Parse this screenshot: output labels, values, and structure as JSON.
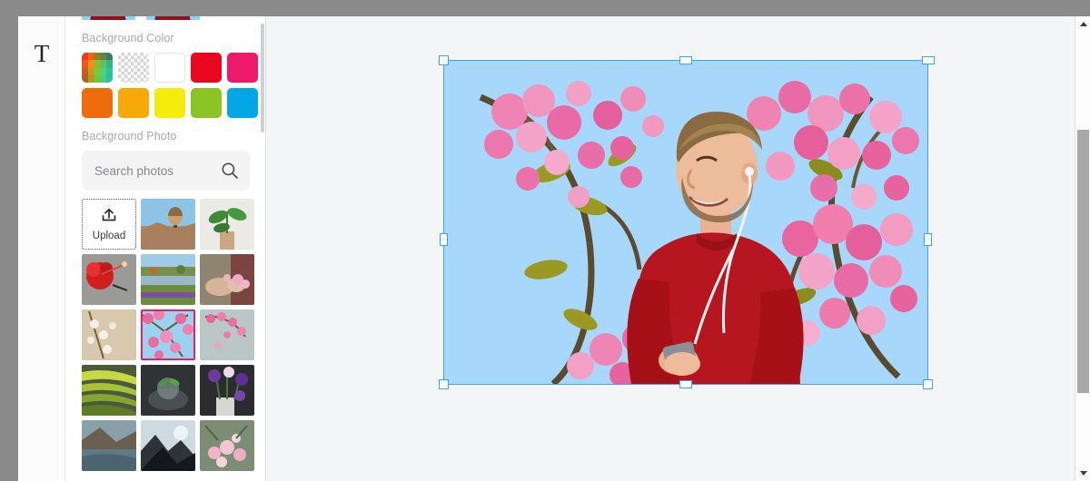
{
  "app": {
    "bg_outer": "#8a8a8a",
    "stage_bg": "#f4f5f6",
    "panel_bg": "#ffffff"
  },
  "tool_rail": {
    "items": [
      {
        "name": "text-tool",
        "glyph": "T",
        "title": "Text"
      }
    ]
  },
  "panel": {
    "template_thumbs": [
      {
        "label": "template-thumb-1"
      },
      {
        "label": "template-thumb-2"
      }
    ],
    "background_color": {
      "label": "Background Color",
      "swatches": [
        {
          "name": "multicolor",
          "kind": "multi",
          "hex": ""
        },
        {
          "name": "transparent",
          "kind": "transparent",
          "hex": ""
        },
        {
          "name": "white",
          "kind": "solid",
          "hex": "#ffffff"
        },
        {
          "name": "red",
          "kind": "solid",
          "hex": "#e8071f"
        },
        {
          "name": "pink",
          "kind": "solid",
          "hex": "#ed1a69"
        },
        {
          "name": "orange",
          "kind": "solid",
          "hex": "#ef6c0c"
        },
        {
          "name": "amber",
          "kind": "solid",
          "hex": "#f6a808"
        },
        {
          "name": "yellow",
          "kind": "solid",
          "hex": "#f6ec0b"
        },
        {
          "name": "green",
          "kind": "solid",
          "hex": "#8cc426"
        },
        {
          "name": "blue",
          "kind": "solid",
          "hex": "#04a7e6"
        }
      ]
    },
    "background_photo": {
      "label": "Background Photo",
      "search": {
        "placeholder": "Search photos",
        "value": "",
        "icon": "search-icon"
      },
      "upload": {
        "label": "Upload",
        "icon": "upload-icon"
      },
      "photos": [
        {
          "name": "hot-air-balloon",
          "selected": false
        },
        {
          "name": "potted-plant",
          "selected": false
        },
        {
          "name": "red-hibiscus",
          "selected": false
        },
        {
          "name": "river-garden",
          "selected": false
        },
        {
          "name": "hands-with-petals",
          "selected": false
        },
        {
          "name": "blossoms-on-sand",
          "selected": false
        },
        {
          "name": "cherry-blossom-sky",
          "selected": true
        },
        {
          "name": "pink-blossom-branch",
          "selected": false
        },
        {
          "name": "green-terraces",
          "selected": false
        },
        {
          "name": "stone-sprout",
          "selected": false
        },
        {
          "name": "purple-bouquet",
          "selected": false
        },
        {
          "name": "mountain-lake",
          "selected": false
        },
        {
          "name": "night-mountain",
          "selected": false
        },
        {
          "name": "flower-cluster",
          "selected": false
        }
      ]
    }
  },
  "canvas": {
    "artboard_name": "design-artboard",
    "background_color": "#a7d8fb",
    "selection": {
      "color": "#3fa2f7",
      "handles": [
        "top-left",
        "top-center",
        "top-right",
        "mid-left",
        "mid-right",
        "bottom-left",
        "bottom-center",
        "bottom-right"
      ]
    },
    "subject": "man-in-red-sweater-with-earphones",
    "scrollbar": {
      "up_arrow": "scroll-up-icon",
      "down_arrow": "scroll-down-icon"
    }
  }
}
